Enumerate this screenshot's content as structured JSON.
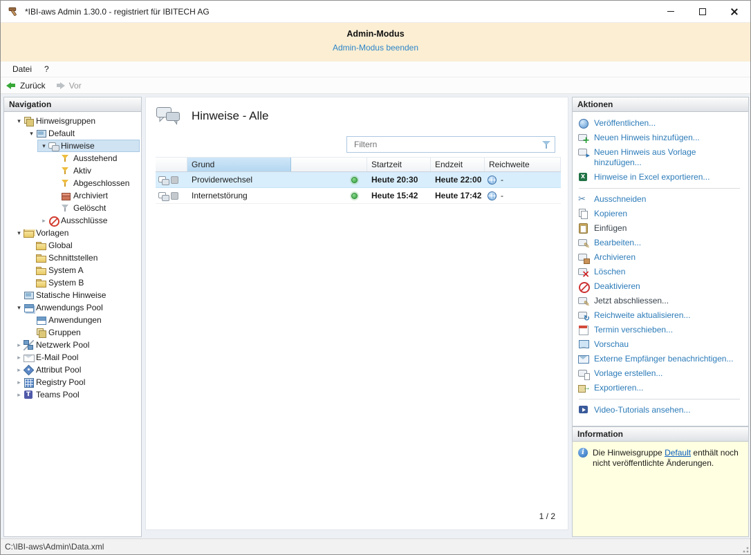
{
  "window": {
    "title": "*IBI-aws Admin 1.30.0 - registriert für IBITECH AG"
  },
  "banner": {
    "title": "Admin-Modus",
    "link": "Admin-Modus beenden"
  },
  "menu": {
    "items": [
      {
        "label": "Datei"
      },
      {
        "label": "?"
      }
    ]
  },
  "toolbar": {
    "back": "Zurück",
    "forward": "Vor"
  },
  "navigation": {
    "header": "Navigation",
    "items": [
      {
        "label": "Hinweisgruppen",
        "level": 0,
        "state": "expanded",
        "icon": "hinweisgruppen-stack-icon"
      },
      {
        "label": "Default",
        "level": 1,
        "state": "expanded",
        "icon": "monitor-icon"
      },
      {
        "label": "Hinweise",
        "level": 2,
        "state": "expanded",
        "icon": "speech-bubbles-icon",
        "selected": true
      },
      {
        "label": "Ausstehend",
        "level": 3,
        "state": "leaf",
        "icon": "filter-yellow-icon"
      },
      {
        "label": "Aktiv",
        "level": 3,
        "state": "leaf",
        "icon": "filter-yellow-icon"
      },
      {
        "label": "Abgeschlossen",
        "level": 3,
        "state": "leaf",
        "icon": "filter-yellow-icon"
      },
      {
        "label": "Archiviert",
        "level": 3,
        "state": "leaf",
        "icon": "archive-box-icon"
      },
      {
        "label": "Gelöscht",
        "level": 3,
        "state": "leaf",
        "icon": "filter-gray-icon"
      },
      {
        "label": "Ausschlüsse",
        "level": 2,
        "state": "collapsed",
        "icon": "exclusion-icon"
      },
      {
        "label": "Vorlagen",
        "level": 0,
        "state": "expanded",
        "icon": "folders-icon"
      },
      {
        "label": "Global",
        "level": 1,
        "state": "leaf",
        "icon": "folder-icon"
      },
      {
        "label": "Schnittstellen",
        "level": 1,
        "state": "leaf",
        "icon": "folder-icon"
      },
      {
        "label": "System A",
        "level": 1,
        "state": "leaf",
        "icon": "folder-icon"
      },
      {
        "label": "System B",
        "level": 1,
        "state": "leaf",
        "icon": "folder-icon"
      },
      {
        "label": "Statische Hinweise",
        "level": 0,
        "state": "leaf",
        "icon": "monitor-icon"
      },
      {
        "label": "Anwendungs Pool",
        "level": 0,
        "state": "expanded",
        "icon": "app-pool-icon"
      },
      {
        "label": "Anwendungen",
        "level": 1,
        "state": "leaf",
        "icon": "window-icon"
      },
      {
        "label": "Gruppen",
        "level": 1,
        "state": "leaf",
        "icon": "group-stack-icon"
      },
      {
        "label": "Netzwerk Pool",
        "level": 0,
        "state": "collapsed",
        "icon": "network-icon"
      },
      {
        "label": "E-Mail Pool",
        "level": 0,
        "state": "collapsed",
        "icon": "mail-icon"
      },
      {
        "label": "Attribut Pool",
        "level": 0,
        "state": "collapsed",
        "icon": "tag-icon"
      },
      {
        "label": "Registry Pool",
        "level": 0,
        "state": "collapsed",
        "icon": "registry-icon"
      },
      {
        "label": "Teams Pool",
        "level": 0,
        "state": "collapsed",
        "icon": "teams-icon"
      }
    ]
  },
  "content": {
    "title": "Hinweise - Alle",
    "filter_placeholder": "Filtern",
    "table": {
      "columns": [
        "",
        "Grund",
        "",
        "Startzeit",
        "Endzeit",
        "Reichweite"
      ],
      "rows": [
        {
          "grund": "Providerwechsel",
          "status": "active",
          "startzeit": "Heute 20:30",
          "endzeit": "Heute 22:00",
          "reichweite": "-",
          "selected": true
        },
        {
          "grund": "Internetstörung",
          "status": "active",
          "startzeit": "Heute 15:42",
          "endzeit": "Heute 17:42",
          "reichweite": "-",
          "selected": false
        }
      ]
    },
    "page_indicator": "1 / 2"
  },
  "actions": {
    "header": "Aktionen",
    "items": [
      {
        "label": "Veröffentlichen...",
        "icon": "publish-globe-icon"
      },
      {
        "label": "Neuen Hinweis hinzufügen...",
        "icon": "add-note-icon"
      },
      {
        "label": "Neuen Hinweis aus Vorlage hinzufügen...",
        "icon": "add-note-from-template-icon"
      },
      {
        "label": "Hinweise in Excel exportieren...",
        "icon": "excel-export-icon"
      },
      {
        "label": "Ausschneiden",
        "icon": "cut-icon"
      },
      {
        "label": "Kopieren",
        "icon": "copy-icon"
      },
      {
        "label": "Einfügen",
        "icon": "paste-icon",
        "variant": "dark"
      },
      {
        "label": "Bearbeiten...",
        "icon": "edit-note-icon"
      },
      {
        "label": "Archivieren",
        "icon": "archive-note-icon"
      },
      {
        "label": "Löschen",
        "icon": "delete-note-icon"
      },
      {
        "label": "Deaktivieren",
        "icon": "deactivate-icon"
      },
      {
        "label": "Jetzt abschliessen...",
        "icon": "finish-now-icon",
        "variant": "dark"
      },
      {
        "label": "Reichweite aktualisieren...",
        "icon": "refresh-scope-icon"
      },
      {
        "label": "Termin verschieben...",
        "icon": "calendar-icon"
      },
      {
        "label": "Vorschau",
        "icon": "preview-monitor-icon"
      },
      {
        "label": "Externe Empfänger benachrichtigen...",
        "icon": "notify-envelope-icon"
      },
      {
        "label": "Vorlage erstellen...",
        "icon": "create-template-icon"
      },
      {
        "label": "Exportieren...",
        "icon": "export-icon"
      },
      {
        "label": "Video-Tutorials ansehen...",
        "icon": "video-icon"
      }
    ]
  },
  "information": {
    "header": "Information",
    "text_before": "Die Hinweisgruppe ",
    "link": "Default",
    "text_after": " enthält noch nicht veröffentlichte Änderungen."
  },
  "statusbar": {
    "path": "C:\\IBI-aws\\Admin\\Data.xml"
  }
}
